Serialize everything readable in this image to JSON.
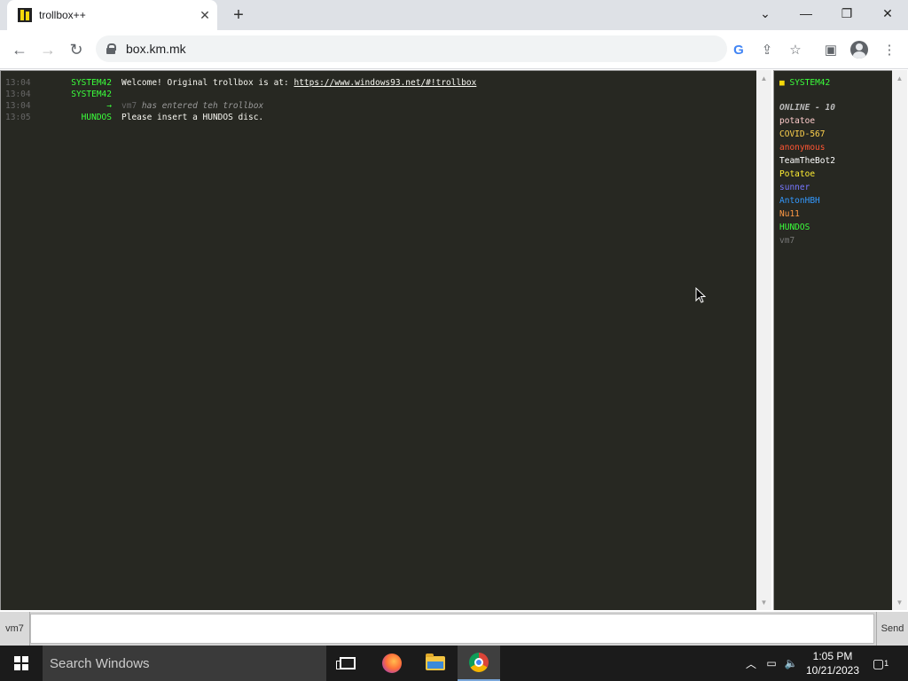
{
  "browser": {
    "tab_title": "trollbox++",
    "url": "box.km.mk"
  },
  "chat": {
    "messages": [
      {
        "time": "13:04",
        "nick": "SYSTEM42",
        "nick_color": "#3bff3b",
        "text": "Welcome! Original trollbox is at: ",
        "link": "https://www.windows93.net/#!trollbox"
      },
      {
        "time": "13:04",
        "nick": "SYSTEM42",
        "nick_color": "#3bff3b",
        "text": ""
      },
      {
        "time": "13:04",
        "nick": "→",
        "nick_color": "#3bff3b",
        "text": "has entered teh trollbox",
        "joined_nick": "vm7"
      },
      {
        "time": "13:05",
        "nick": "HUNDOS",
        "nick_color": "#3bff3b",
        "text": "Please insert a HUNDOS disc."
      }
    ]
  },
  "userlist": {
    "system_user": "SYSTEM42",
    "online_label": "ONLINE - 10",
    "users": [
      {
        "name": "potatoe",
        "color": "#ffcccc"
      },
      {
        "name": "COVID-567",
        "color": "#ffd24d"
      },
      {
        "name": "anonymous",
        "color": "#ff5533"
      },
      {
        "name": "TeamTheBot2",
        "color": "#ffffff"
      },
      {
        "name": "Potatoe",
        "color": "#ffee33"
      },
      {
        "name": "sunner",
        "color": "#7777ff"
      },
      {
        "name": "AntonHBH",
        "color": "#3399ff"
      },
      {
        "name": "Nu11",
        "color": "#ff9944"
      },
      {
        "name": "HUNDOS",
        "color": "#3bff3b"
      },
      {
        "name": "vm7",
        "color": "#777777"
      }
    ]
  },
  "inputbar": {
    "nick": "vm7",
    "value": "",
    "send_label": "Send"
  },
  "taskbar": {
    "search_placeholder": "Search Windows",
    "time": "1:05 PM",
    "date": "10/21/2023",
    "notification_count": "1"
  }
}
